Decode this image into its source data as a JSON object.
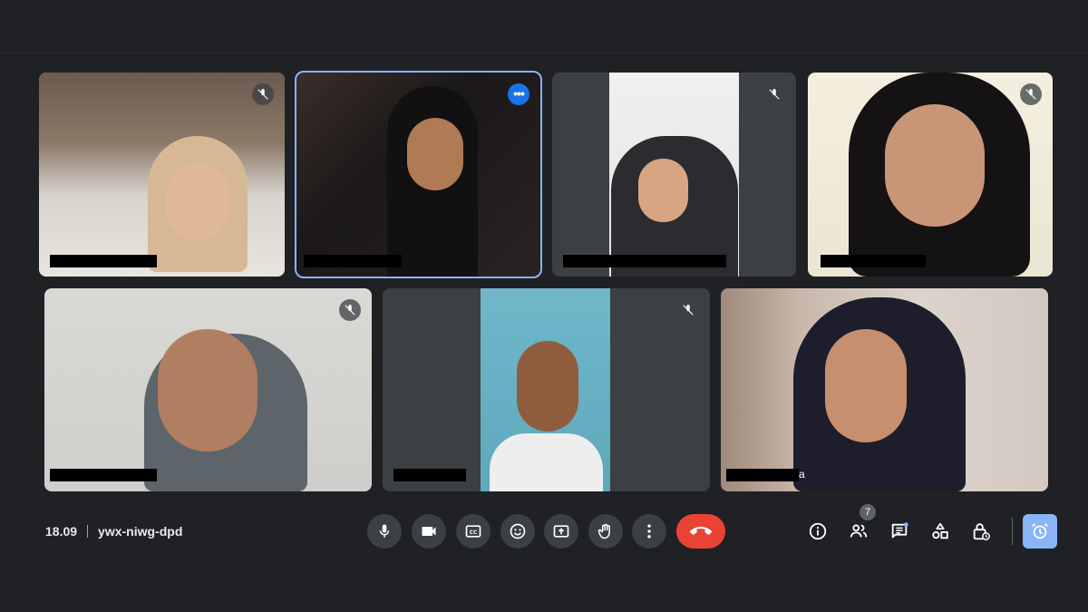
{
  "meeting": {
    "time": "18.09",
    "code": "ywx-niwg-dpd"
  },
  "participants": [
    {
      "muted": true,
      "name_hidden": true
    },
    {
      "muted": false,
      "active_speaker": true,
      "name_hidden": true
    },
    {
      "muted": true,
      "name_hidden": true
    },
    {
      "muted": true,
      "name_hidden": true
    },
    {
      "muted": true,
      "name_hidden": true
    },
    {
      "muted": true,
      "name_hidden": true
    },
    {
      "muted": false,
      "name_hidden": true,
      "name_suffix": "a"
    }
  ],
  "controls": {
    "mic": "mic-icon",
    "camera": "camera-icon",
    "captions": "closed-captions-icon",
    "reactions": "emoji-icon",
    "present": "present-screen-icon",
    "raise_hand": "raise-hand-icon",
    "more": "more-options-icon",
    "leave": "hang-up-icon"
  },
  "side_controls": {
    "info": "info-icon",
    "people_count": "7",
    "chat": "chat-icon",
    "activities": "activities-icon",
    "host_controls": "host-controls-icon",
    "timer": "alarm-icon"
  },
  "colors": {
    "background": "#202124",
    "tile": "#3c4043",
    "active_outline": "#8ab4f8",
    "end_call": "#ea4335",
    "accent": "#1a73e8"
  }
}
